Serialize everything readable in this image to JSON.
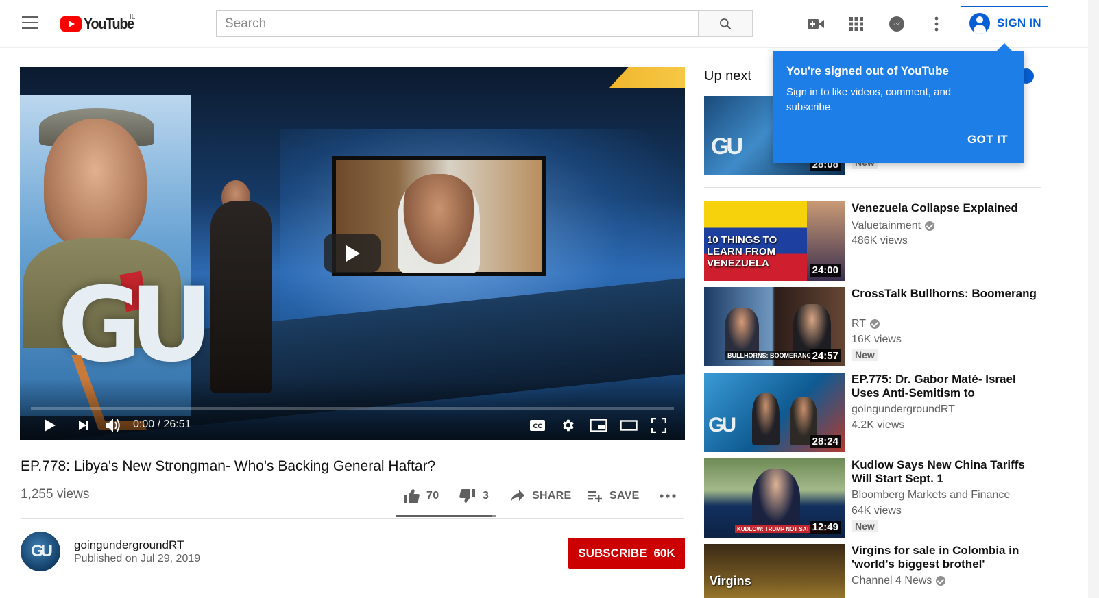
{
  "header": {
    "logo_text": "YouTube",
    "country_code": "IL",
    "search_placeholder": "Search",
    "sign_in_label": "SIGN IN",
    "icons": [
      "menu-icon",
      "search-icon",
      "create-video-icon",
      "apps-grid-icon",
      "messages-icon",
      "more-vert-icon",
      "account-icon"
    ]
  },
  "player": {
    "time_current": "0:00",
    "time_separator": " / ",
    "time_total": "26:51",
    "progress_fraction": 0.0,
    "controls": [
      "play-icon",
      "next-icon",
      "volume-icon",
      "captions-icon",
      "settings-icon",
      "miniplayer-icon",
      "theater-mode-icon",
      "fullscreen-icon"
    ]
  },
  "video": {
    "title": "EP.778: Libya's New Strongman- Who's Backing General Haftar?",
    "views": "1,255 views",
    "likes": "70",
    "dislikes": "3",
    "share_label": "SHARE",
    "save_label": "SAVE",
    "like_fraction": 0.959
  },
  "owner": {
    "avatar_text": "GU",
    "name": "goingundergroundRT",
    "published": "Published on Jul 29, 2019",
    "subscribe_label": "SUBSCRIBE",
    "subscriber_count": "60K"
  },
  "sidebar": {
    "up_next_label": "Up next",
    "items": [
      {
        "title": "",
        "channel": "",
        "views": "",
        "badge": "New",
        "duration": "28:08"
      },
      {
        "title": "Venezuela Collapse Explained",
        "channel": "Valuetainment",
        "views": "486K views",
        "badge": "",
        "duration": "24:00",
        "thumb_text": "10 THINGS TO LEARN FROM VENEZUELA"
      },
      {
        "title": "CrossTalk Bullhorns: Boomerang",
        "channel": "RT",
        "views": "16K views",
        "badge": "New",
        "duration": "24:57",
        "thumb_text": "BULLHORNS: BOOMERANG"
      },
      {
        "title": "EP.775: Dr. Gabor Maté- Israel Uses Anti-Semitism to",
        "channel": "goingundergroundRT",
        "views": "4.2K views",
        "badge": "",
        "duration": "28:24"
      },
      {
        "title": "Kudlow Says New China Tariffs Will Start Sept. 1",
        "channel": "Bloomberg Markets and Finance",
        "views": "64K views",
        "badge": "New",
        "duration": "12:49",
        "thumb_text": "KUDLOW: TRUMP NOT SATISFIED"
      },
      {
        "title": "Virgins for sale in Colombia in 'world's biggest brothel'",
        "channel": "Channel 4 News",
        "views": "",
        "badge": "",
        "duration": "",
        "thumb_text": "Virgins"
      }
    ]
  },
  "tooltip": {
    "title": "You're signed out of YouTube",
    "body": "Sign in to like videos, comment, and subscribe.",
    "button": "GOT IT"
  },
  "colors": {
    "brand_red": "#ff0000",
    "subscribe_red": "#cc0000",
    "link_blue": "#065fd4",
    "tooltip_blue": "#1c7ee6",
    "secondary_text": "#606060"
  }
}
